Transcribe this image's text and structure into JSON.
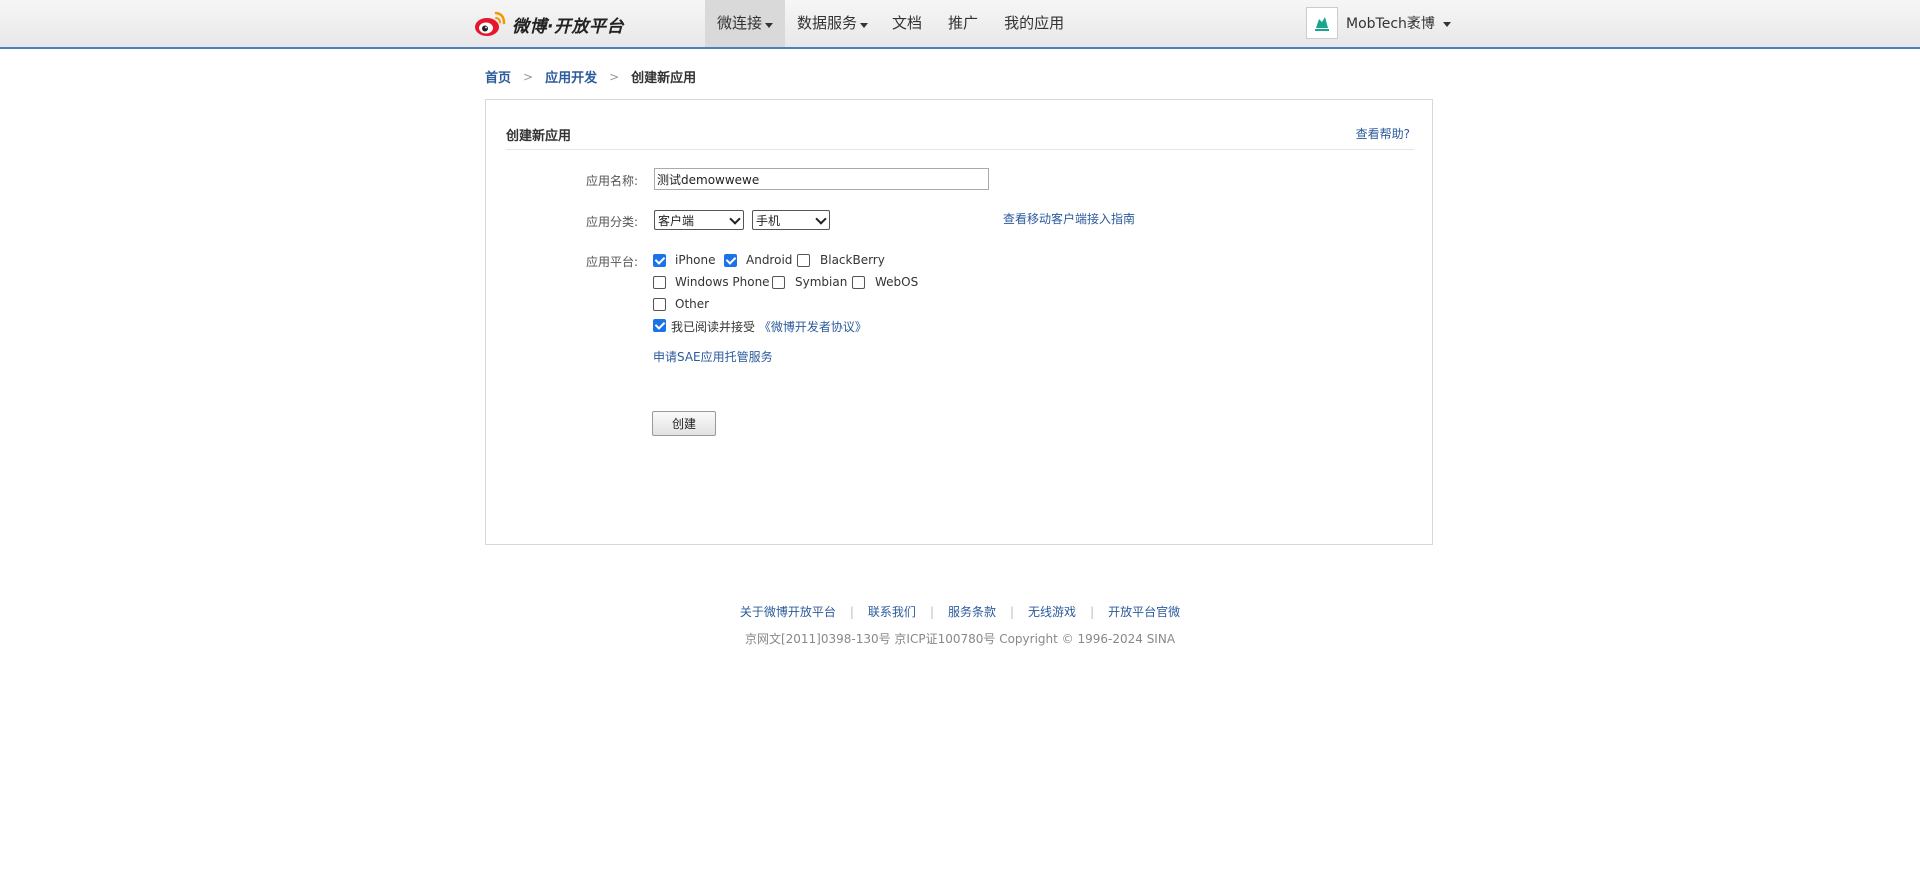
{
  "header": {
    "logo_text": "微博·开放平台",
    "nav": [
      {
        "label": "微连接",
        "dropdown": true,
        "active": true
      },
      {
        "label": "数据服务",
        "dropdown": true,
        "active": false
      },
      {
        "label": "文档",
        "dropdown": false,
        "active": false
      },
      {
        "label": "推广",
        "dropdown": false,
        "active": false
      },
      {
        "label": "我的应用",
        "dropdown": false,
        "active": false
      }
    ],
    "user_name": "MobTech袤博"
  },
  "breadcrumb": {
    "home": "首页",
    "app_dev": "应用开发",
    "current": "创建新应用"
  },
  "panel": {
    "title": "创建新应用",
    "help": "查看帮助?",
    "form": {
      "name_label": "应用名称:",
      "name_value": "测试demowwewe",
      "category_label": "应用分类:",
      "category_value": "客户端",
      "subcategory_value": "手机",
      "guide_link": "查看移动客户端接入指南",
      "platform_label": "应用平台:",
      "platforms": [
        {
          "label": "iPhone",
          "checked": true
        },
        {
          "label": "Android",
          "checked": true
        },
        {
          "label": "BlackBerry",
          "checked": false
        },
        {
          "label": "Windows Phone",
          "checked": false
        },
        {
          "label": "Symbian",
          "checked": false
        },
        {
          "label": "WebOS",
          "checked": false
        },
        {
          "label": "Other",
          "checked": false
        }
      ],
      "agree_text": "我已阅读并接受",
      "agree_link": "《微博开发者协议》",
      "agree_checked": true,
      "sae_link": "申请SAE应用托管服务",
      "create_button": "创建"
    }
  },
  "footer": {
    "links": [
      "关于微博开放平台",
      "联系我们",
      "服务条款",
      "无线游戏",
      "开放平台官微"
    ],
    "copyright": "京网文[2011]0398-130号 京ICP证100780号 Copyright © 1996-2024 SINA"
  },
  "colors": {
    "link": "#2b5b9b",
    "checkbox_checked": "#1a73e8",
    "topbar_border": "#4a7fc0",
    "weibo_red": "#e6162d"
  }
}
